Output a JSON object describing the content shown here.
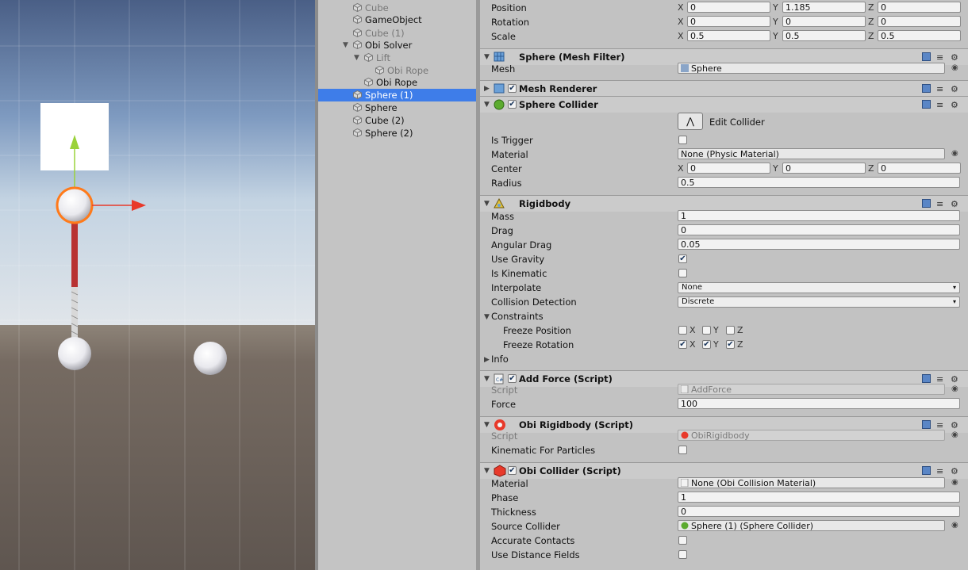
{
  "hierarchy": {
    "items": [
      {
        "label": "Cube",
        "dim": true
      },
      {
        "label": "GameObject",
        "dim": false
      },
      {
        "label": "Cube (1)",
        "dim": true
      },
      {
        "label": "Obi Solver",
        "dim": false
      },
      {
        "label": "Lift",
        "dim": true
      },
      {
        "label": "Obi Rope",
        "dim": true
      },
      {
        "label": "Obi Rope",
        "dim": false
      },
      {
        "label": "Sphere (1)",
        "dim": false
      },
      {
        "label": "Sphere",
        "dim": false
      },
      {
        "label": "Cube (2)",
        "dim": false
      },
      {
        "label": "Sphere (2)",
        "dim": false
      }
    ]
  },
  "transform": {
    "position": {
      "label": "Position",
      "x": "0",
      "y": "1.185",
      "z": "0"
    },
    "rotation": {
      "label": "Rotation",
      "x": "0",
      "y": "0",
      "z": "0"
    },
    "scale": {
      "label": "Scale",
      "x": "0.5",
      "y": "0.5",
      "z": "0.5"
    },
    "axis_x": "X",
    "axis_y": "Y",
    "axis_z": "Z"
  },
  "mesh_filter": {
    "title": "Sphere (Mesh Filter)",
    "mesh_label": "Mesh",
    "mesh_value": "Sphere"
  },
  "mesh_renderer": {
    "title": "Mesh Renderer"
  },
  "sphere_collider": {
    "title": "Sphere Collider",
    "edit_label": "Edit Collider",
    "is_trigger_label": "Is Trigger",
    "material_label": "Material",
    "material_value": "None (Physic Material)",
    "center_label": "Center",
    "center_x": "0",
    "center_y": "0",
    "center_z": "0",
    "radius_label": "Radius",
    "radius_value": "0.5"
  },
  "rigidbody": {
    "title": "Rigidbody",
    "mass_label": "Mass",
    "mass_value": "1",
    "drag_label": "Drag",
    "drag_value": "0",
    "angular_drag_label": "Angular Drag",
    "angular_drag_value": "0.05",
    "use_gravity_label": "Use Gravity",
    "is_kinematic_label": "Is Kinematic",
    "interpolate_label": "Interpolate",
    "interpolate_value": "None",
    "collision_label": "Collision Detection",
    "collision_value": "Discrete",
    "constraints_label": "Constraints",
    "freeze_position_label": "Freeze Position",
    "freeze_rotation_label": "Freeze Rotation",
    "info_label": "Info"
  },
  "add_force": {
    "title": "Add Force (Script)",
    "script_label": "Script",
    "script_value": "AddForce",
    "force_label": "Force",
    "force_value": "100"
  },
  "obi_rigidbody": {
    "title": "Obi Rigidbody (Script)",
    "script_label": "Script",
    "script_value": "ObiRigidbody",
    "kinematic_label": "Kinematic For Particles"
  },
  "obi_collider": {
    "title": "Obi Collider (Script)",
    "material_label": "Material",
    "material_value": "None (Obi Collision Material)",
    "phase_label": "Phase",
    "phase_value": "1",
    "thickness_label": "Thickness",
    "thickness_value": "0",
    "source_label": "Source Collider",
    "source_value": "Sphere (1) (Sphere Collider)",
    "accurate_label": "Accurate Contacts",
    "distance_label": "Use Distance Fields"
  },
  "colors": {
    "selection": "#3e7de9",
    "orange_outline": "#ff7a1a",
    "arrow_red": "#e8392a",
    "arrow_green": "#9ad23a"
  }
}
